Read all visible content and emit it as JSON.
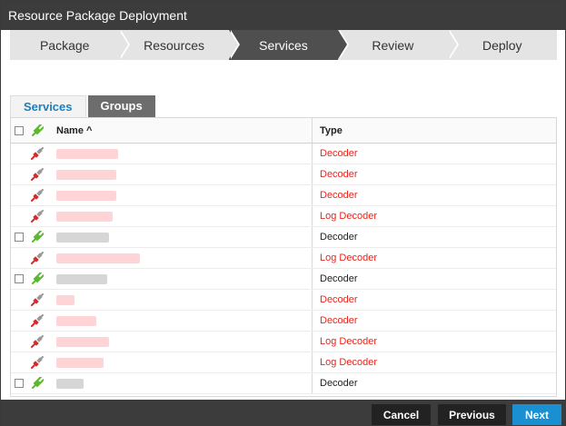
{
  "window": {
    "title": "Resource Package Deployment"
  },
  "wizard": {
    "steps": [
      {
        "label": "Package",
        "active": false
      },
      {
        "label": "Resources",
        "active": false
      },
      {
        "label": "Services",
        "active": true
      },
      {
        "label": "Review",
        "active": false
      },
      {
        "label": "Deploy",
        "active": false
      }
    ]
  },
  "tabs": [
    {
      "label": "Services",
      "active": true
    },
    {
      "label": "Groups",
      "active": false
    }
  ],
  "grid": {
    "columns": {
      "name": "Name ^",
      "type": "Type"
    },
    "rows": [
      {
        "type": "Decoder",
        "status": "disconnected",
        "checkbox": false
      },
      {
        "type": "Decoder",
        "status": "disconnected",
        "checkbox": false
      },
      {
        "type": "Decoder",
        "status": "disconnected",
        "checkbox": false
      },
      {
        "type": "Log Decoder",
        "status": "disconnected",
        "checkbox": false
      },
      {
        "type": "Decoder",
        "status": "connected",
        "checkbox": true
      },
      {
        "type": "Log Decoder",
        "status": "disconnected",
        "checkbox": false
      },
      {
        "type": "Decoder",
        "status": "connected",
        "checkbox": true
      },
      {
        "type": "Decoder",
        "status": "disconnected",
        "checkbox": false
      },
      {
        "type": "Decoder",
        "status": "disconnected",
        "checkbox": false
      },
      {
        "type": "Log Decoder",
        "status": "disconnected",
        "checkbox": false
      },
      {
        "type": "Log Decoder",
        "status": "disconnected",
        "checkbox": false
      },
      {
        "type": "Decoder",
        "status": "connected",
        "checkbox": true
      }
    ]
  },
  "footer": {
    "cancel": "Cancel",
    "previous": "Previous",
    "next": "Next"
  },
  "colors": {
    "accent": "#1a8fd1",
    "error_text": "#e8261d",
    "connected_icon": "#5cb82e",
    "disconnected_icon": "#d82a2a"
  },
  "icons": {
    "connected": "plug-connected-icon",
    "disconnected": "plug-disconnected-icon"
  }
}
